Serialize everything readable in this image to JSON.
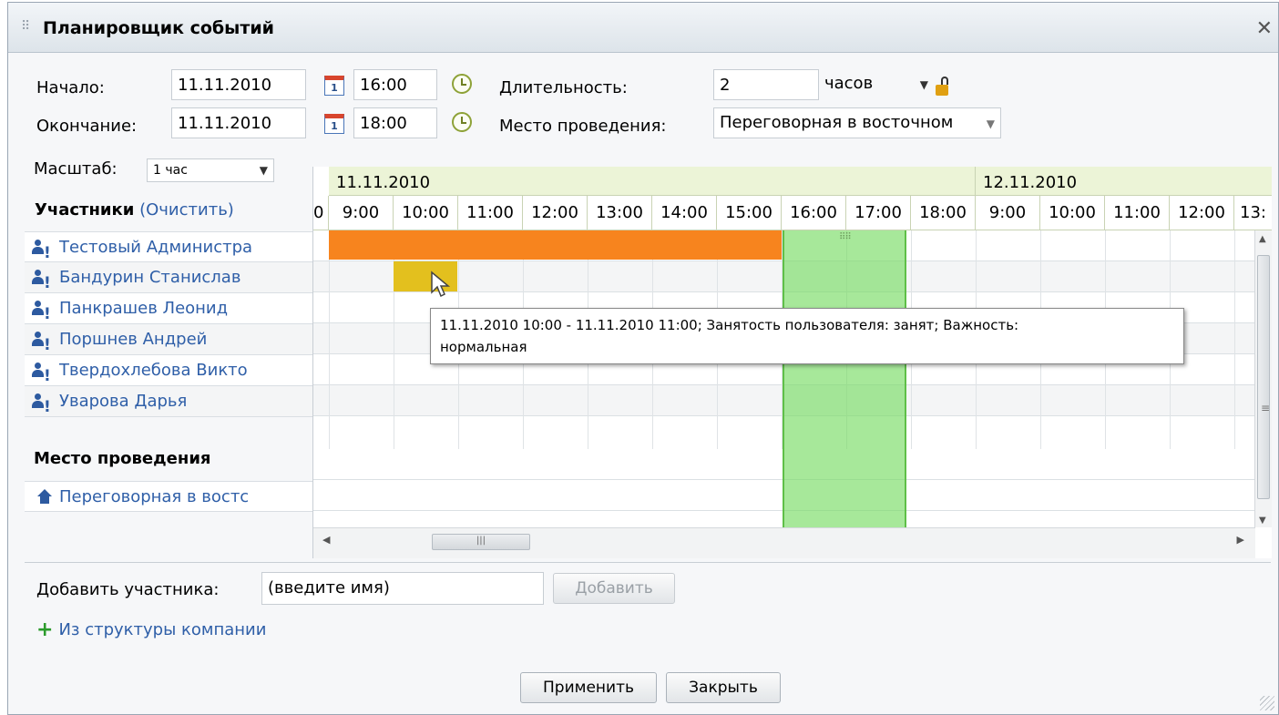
{
  "dialog": {
    "title": "Планировщик событий"
  },
  "form": {
    "start_label": "Начало:",
    "start_date": "11.11.2010",
    "start_time": "16:00",
    "end_label": "Окончание:",
    "end_date": "11.11.2010",
    "end_time": "18:00",
    "duration_label": "Длительность:",
    "duration_value": "2",
    "duration_unit": "часов",
    "place_label": "Место проведения:",
    "place_value": "Переговорная в восточном",
    "calendar_icon_text": "1"
  },
  "scale": {
    "label": "Масштаб:",
    "value": "1 час"
  },
  "participants": {
    "heading": "Участники",
    "clear_link": "(Очистить)",
    "items": [
      {
        "name": "Тестовый Администра"
      },
      {
        "name": "Бандурин Станислав"
      },
      {
        "name": "Панкрашев Леонид"
      },
      {
        "name": "Поршнев Андрей"
      },
      {
        "name": "Твердохлебова Викто"
      },
      {
        "name": "Уварова Дарья"
      }
    ],
    "excl": "!"
  },
  "place_section": {
    "heading": "Место проведения",
    "item": "Переговорная в востс"
  },
  "timeline": {
    "dates": [
      "11.11.2010",
      "12.11.2010"
    ],
    "hours": [
      "0",
      "9:00",
      "10:00",
      "11:00",
      "12:00",
      "13:00",
      "14:00",
      "15:00",
      "16:00",
      "17:00",
      "18:00",
      "9:00",
      "10:00",
      "11:00",
      "12:00",
      "13:"
    ]
  },
  "tooltip": {
    "line1": "11.11.2010 10:00 - 11.11.2010 11:00; Занятость пользователя: занят; Важность:",
    "line2": "нормальная"
  },
  "add": {
    "label": "Добавить участника:",
    "placeholder": "(введите имя)",
    "button": "Добавить",
    "structure_link": "Из структуры компании"
  },
  "footer": {
    "apply": "Применить",
    "close": "Закрыть"
  },
  "colors": {
    "busy": "#f7841e",
    "busy_tentative": "#e3c01e",
    "selection": "#8fe07a",
    "date_header": "#ecf4d7",
    "link": "#2f5fa8"
  }
}
